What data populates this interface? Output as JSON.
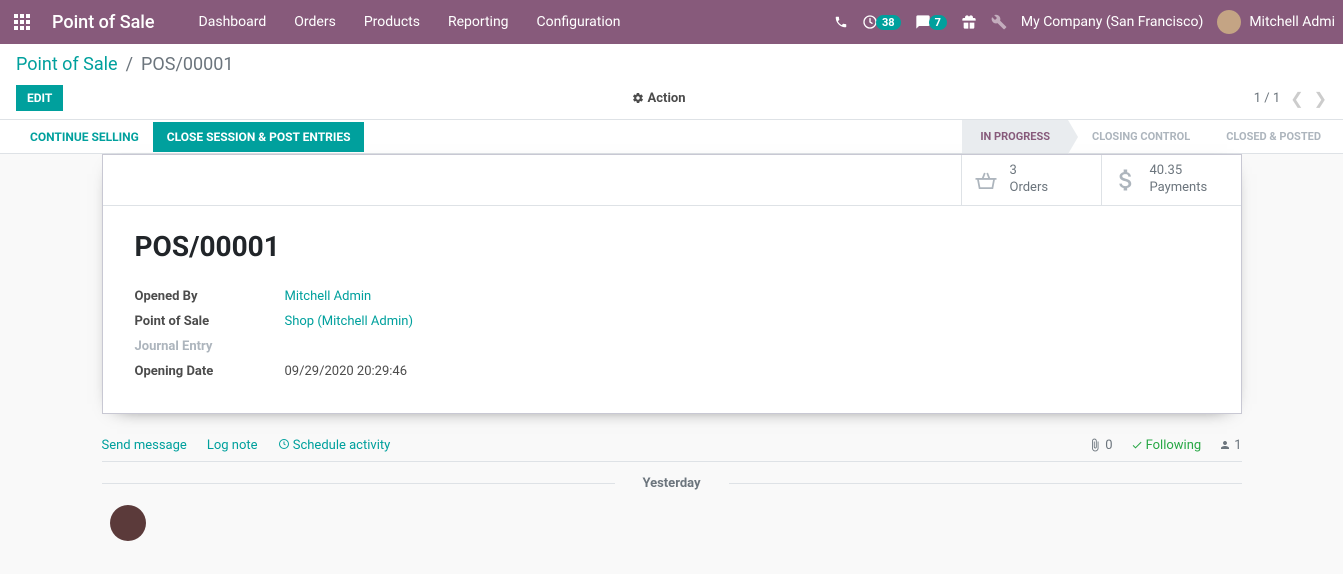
{
  "nav": {
    "brand": "Point of Sale",
    "menu": [
      "Dashboard",
      "Orders",
      "Products",
      "Reporting",
      "Configuration"
    ],
    "activity_count": "38",
    "message_count": "7",
    "company": "My Company (San Francisco)",
    "user": "Mitchell Admi"
  },
  "breadcrumb": {
    "root": "Point of Sale",
    "current": "POS/00001"
  },
  "controls": {
    "edit": "Edit",
    "action": "Action",
    "pager": "1 / 1"
  },
  "statusbar": {
    "continue": "Continue Selling",
    "close": "Close Session & Post Entries",
    "steps": {
      "in_progress": "In Progress",
      "closing": "Closing Control",
      "closed": "Closed & Posted"
    }
  },
  "stats": {
    "orders_count": "3",
    "orders_label": "Orders",
    "payments_amount": "40.35",
    "payments_label": "Payments"
  },
  "record": {
    "title": "POS/00001",
    "labels": {
      "opened_by": "Opened By",
      "pos": "Point of Sale",
      "journal": "Journal Entry",
      "opening_date": "Opening Date"
    },
    "values": {
      "opened_by": "Mitchell Admin",
      "pos": "Shop (Mitchell Admin)",
      "opening_date": "09/29/2020 20:29:46"
    }
  },
  "chatter": {
    "send": "Send message",
    "log": "Log note",
    "schedule": "Schedule activity",
    "attach_count": "0",
    "following": "Following",
    "follower_count": "1",
    "date_sep": "Yesterday"
  }
}
